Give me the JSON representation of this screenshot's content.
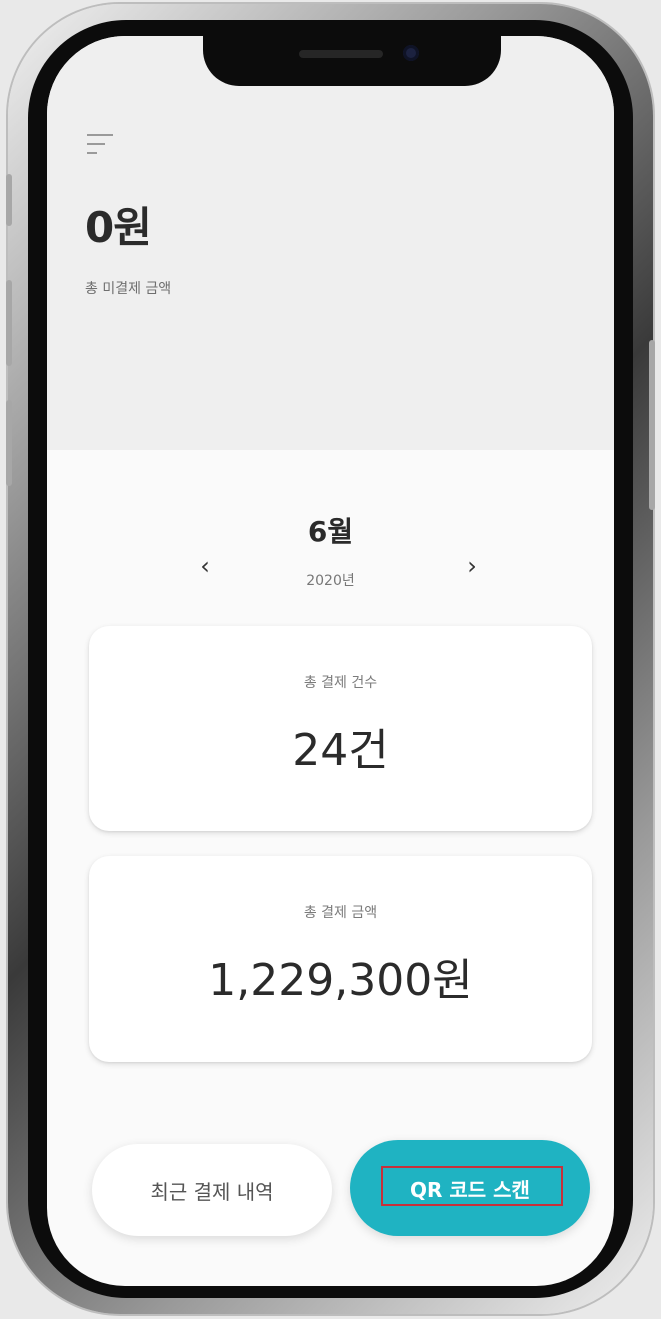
{
  "summary": {
    "outstanding_amount": "0원",
    "outstanding_label": "총 미결제 금액"
  },
  "period": {
    "month": "6월",
    "year": "2020년",
    "prev_arrow": "‹",
    "next_arrow": "›"
  },
  "stats": {
    "count_label": "총 결제 건수",
    "count_value": "24건",
    "amount_label": "총 결제 금액",
    "amount_value": "1,229,300원"
  },
  "actions": {
    "history_label": "최근 결제 내역",
    "qr_label": "QR 코드 스캔"
  },
  "icons": {
    "menu": "menu-icon"
  },
  "colors": {
    "accent": "#1fb3c2",
    "top_panel": "#efefef",
    "highlight": "#c8303a"
  }
}
